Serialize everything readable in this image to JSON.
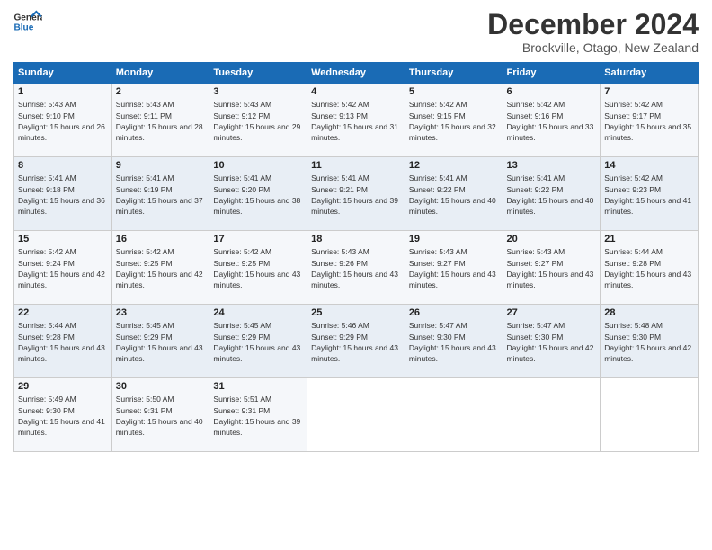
{
  "logo": {
    "line1": "General",
    "line2": "Blue"
  },
  "title": "December 2024",
  "subtitle": "Brockville, Otago, New Zealand",
  "weekdays": [
    "Sunday",
    "Monday",
    "Tuesday",
    "Wednesday",
    "Thursday",
    "Friday",
    "Saturday"
  ],
  "weeks": [
    [
      {
        "day": "1",
        "sunrise": "5:43 AM",
        "sunset": "9:10 PM",
        "daylight": "15 hours and 26 minutes."
      },
      {
        "day": "2",
        "sunrise": "5:43 AM",
        "sunset": "9:11 PM",
        "daylight": "15 hours and 28 minutes."
      },
      {
        "day": "3",
        "sunrise": "5:43 AM",
        "sunset": "9:12 PM",
        "daylight": "15 hours and 29 minutes."
      },
      {
        "day": "4",
        "sunrise": "5:42 AM",
        "sunset": "9:13 PM",
        "daylight": "15 hours and 31 minutes."
      },
      {
        "day": "5",
        "sunrise": "5:42 AM",
        "sunset": "9:15 PM",
        "daylight": "15 hours and 32 minutes."
      },
      {
        "day": "6",
        "sunrise": "5:42 AM",
        "sunset": "9:16 PM",
        "daylight": "15 hours and 33 minutes."
      },
      {
        "day": "7",
        "sunrise": "5:42 AM",
        "sunset": "9:17 PM",
        "daylight": "15 hours and 35 minutes."
      }
    ],
    [
      {
        "day": "8",
        "sunrise": "5:41 AM",
        "sunset": "9:18 PM",
        "daylight": "15 hours and 36 minutes."
      },
      {
        "day": "9",
        "sunrise": "5:41 AM",
        "sunset": "9:19 PM",
        "daylight": "15 hours and 37 minutes."
      },
      {
        "day": "10",
        "sunrise": "5:41 AM",
        "sunset": "9:20 PM",
        "daylight": "15 hours and 38 minutes."
      },
      {
        "day": "11",
        "sunrise": "5:41 AM",
        "sunset": "9:21 PM",
        "daylight": "15 hours and 39 minutes."
      },
      {
        "day": "12",
        "sunrise": "5:41 AM",
        "sunset": "9:22 PM",
        "daylight": "15 hours and 40 minutes."
      },
      {
        "day": "13",
        "sunrise": "5:41 AM",
        "sunset": "9:22 PM",
        "daylight": "15 hours and 40 minutes."
      },
      {
        "day": "14",
        "sunrise": "5:42 AM",
        "sunset": "9:23 PM",
        "daylight": "15 hours and 41 minutes."
      }
    ],
    [
      {
        "day": "15",
        "sunrise": "5:42 AM",
        "sunset": "9:24 PM",
        "daylight": "15 hours and 42 minutes."
      },
      {
        "day": "16",
        "sunrise": "5:42 AM",
        "sunset": "9:25 PM",
        "daylight": "15 hours and 42 minutes."
      },
      {
        "day": "17",
        "sunrise": "5:42 AM",
        "sunset": "9:25 PM",
        "daylight": "15 hours and 43 minutes."
      },
      {
        "day": "18",
        "sunrise": "5:43 AM",
        "sunset": "9:26 PM",
        "daylight": "15 hours and 43 minutes."
      },
      {
        "day": "19",
        "sunrise": "5:43 AM",
        "sunset": "9:27 PM",
        "daylight": "15 hours and 43 minutes."
      },
      {
        "day": "20",
        "sunrise": "5:43 AM",
        "sunset": "9:27 PM",
        "daylight": "15 hours and 43 minutes."
      },
      {
        "day": "21",
        "sunrise": "5:44 AM",
        "sunset": "9:28 PM",
        "daylight": "15 hours and 43 minutes."
      }
    ],
    [
      {
        "day": "22",
        "sunrise": "5:44 AM",
        "sunset": "9:28 PM",
        "daylight": "15 hours and 43 minutes."
      },
      {
        "day": "23",
        "sunrise": "5:45 AM",
        "sunset": "9:29 PM",
        "daylight": "15 hours and 43 minutes."
      },
      {
        "day": "24",
        "sunrise": "5:45 AM",
        "sunset": "9:29 PM",
        "daylight": "15 hours and 43 minutes."
      },
      {
        "day": "25",
        "sunrise": "5:46 AM",
        "sunset": "9:29 PM",
        "daylight": "15 hours and 43 minutes."
      },
      {
        "day": "26",
        "sunrise": "5:47 AM",
        "sunset": "9:30 PM",
        "daylight": "15 hours and 43 minutes."
      },
      {
        "day": "27",
        "sunrise": "5:47 AM",
        "sunset": "9:30 PM",
        "daylight": "15 hours and 42 minutes."
      },
      {
        "day": "28",
        "sunrise": "5:48 AM",
        "sunset": "9:30 PM",
        "daylight": "15 hours and 42 minutes."
      }
    ],
    [
      {
        "day": "29",
        "sunrise": "5:49 AM",
        "sunset": "9:30 PM",
        "daylight": "15 hours and 41 minutes."
      },
      {
        "day": "30",
        "sunrise": "5:50 AM",
        "sunset": "9:31 PM",
        "daylight": "15 hours and 40 minutes."
      },
      {
        "day": "31",
        "sunrise": "5:51 AM",
        "sunset": "9:31 PM",
        "daylight": "15 hours and 39 minutes."
      },
      null,
      null,
      null,
      null
    ]
  ]
}
